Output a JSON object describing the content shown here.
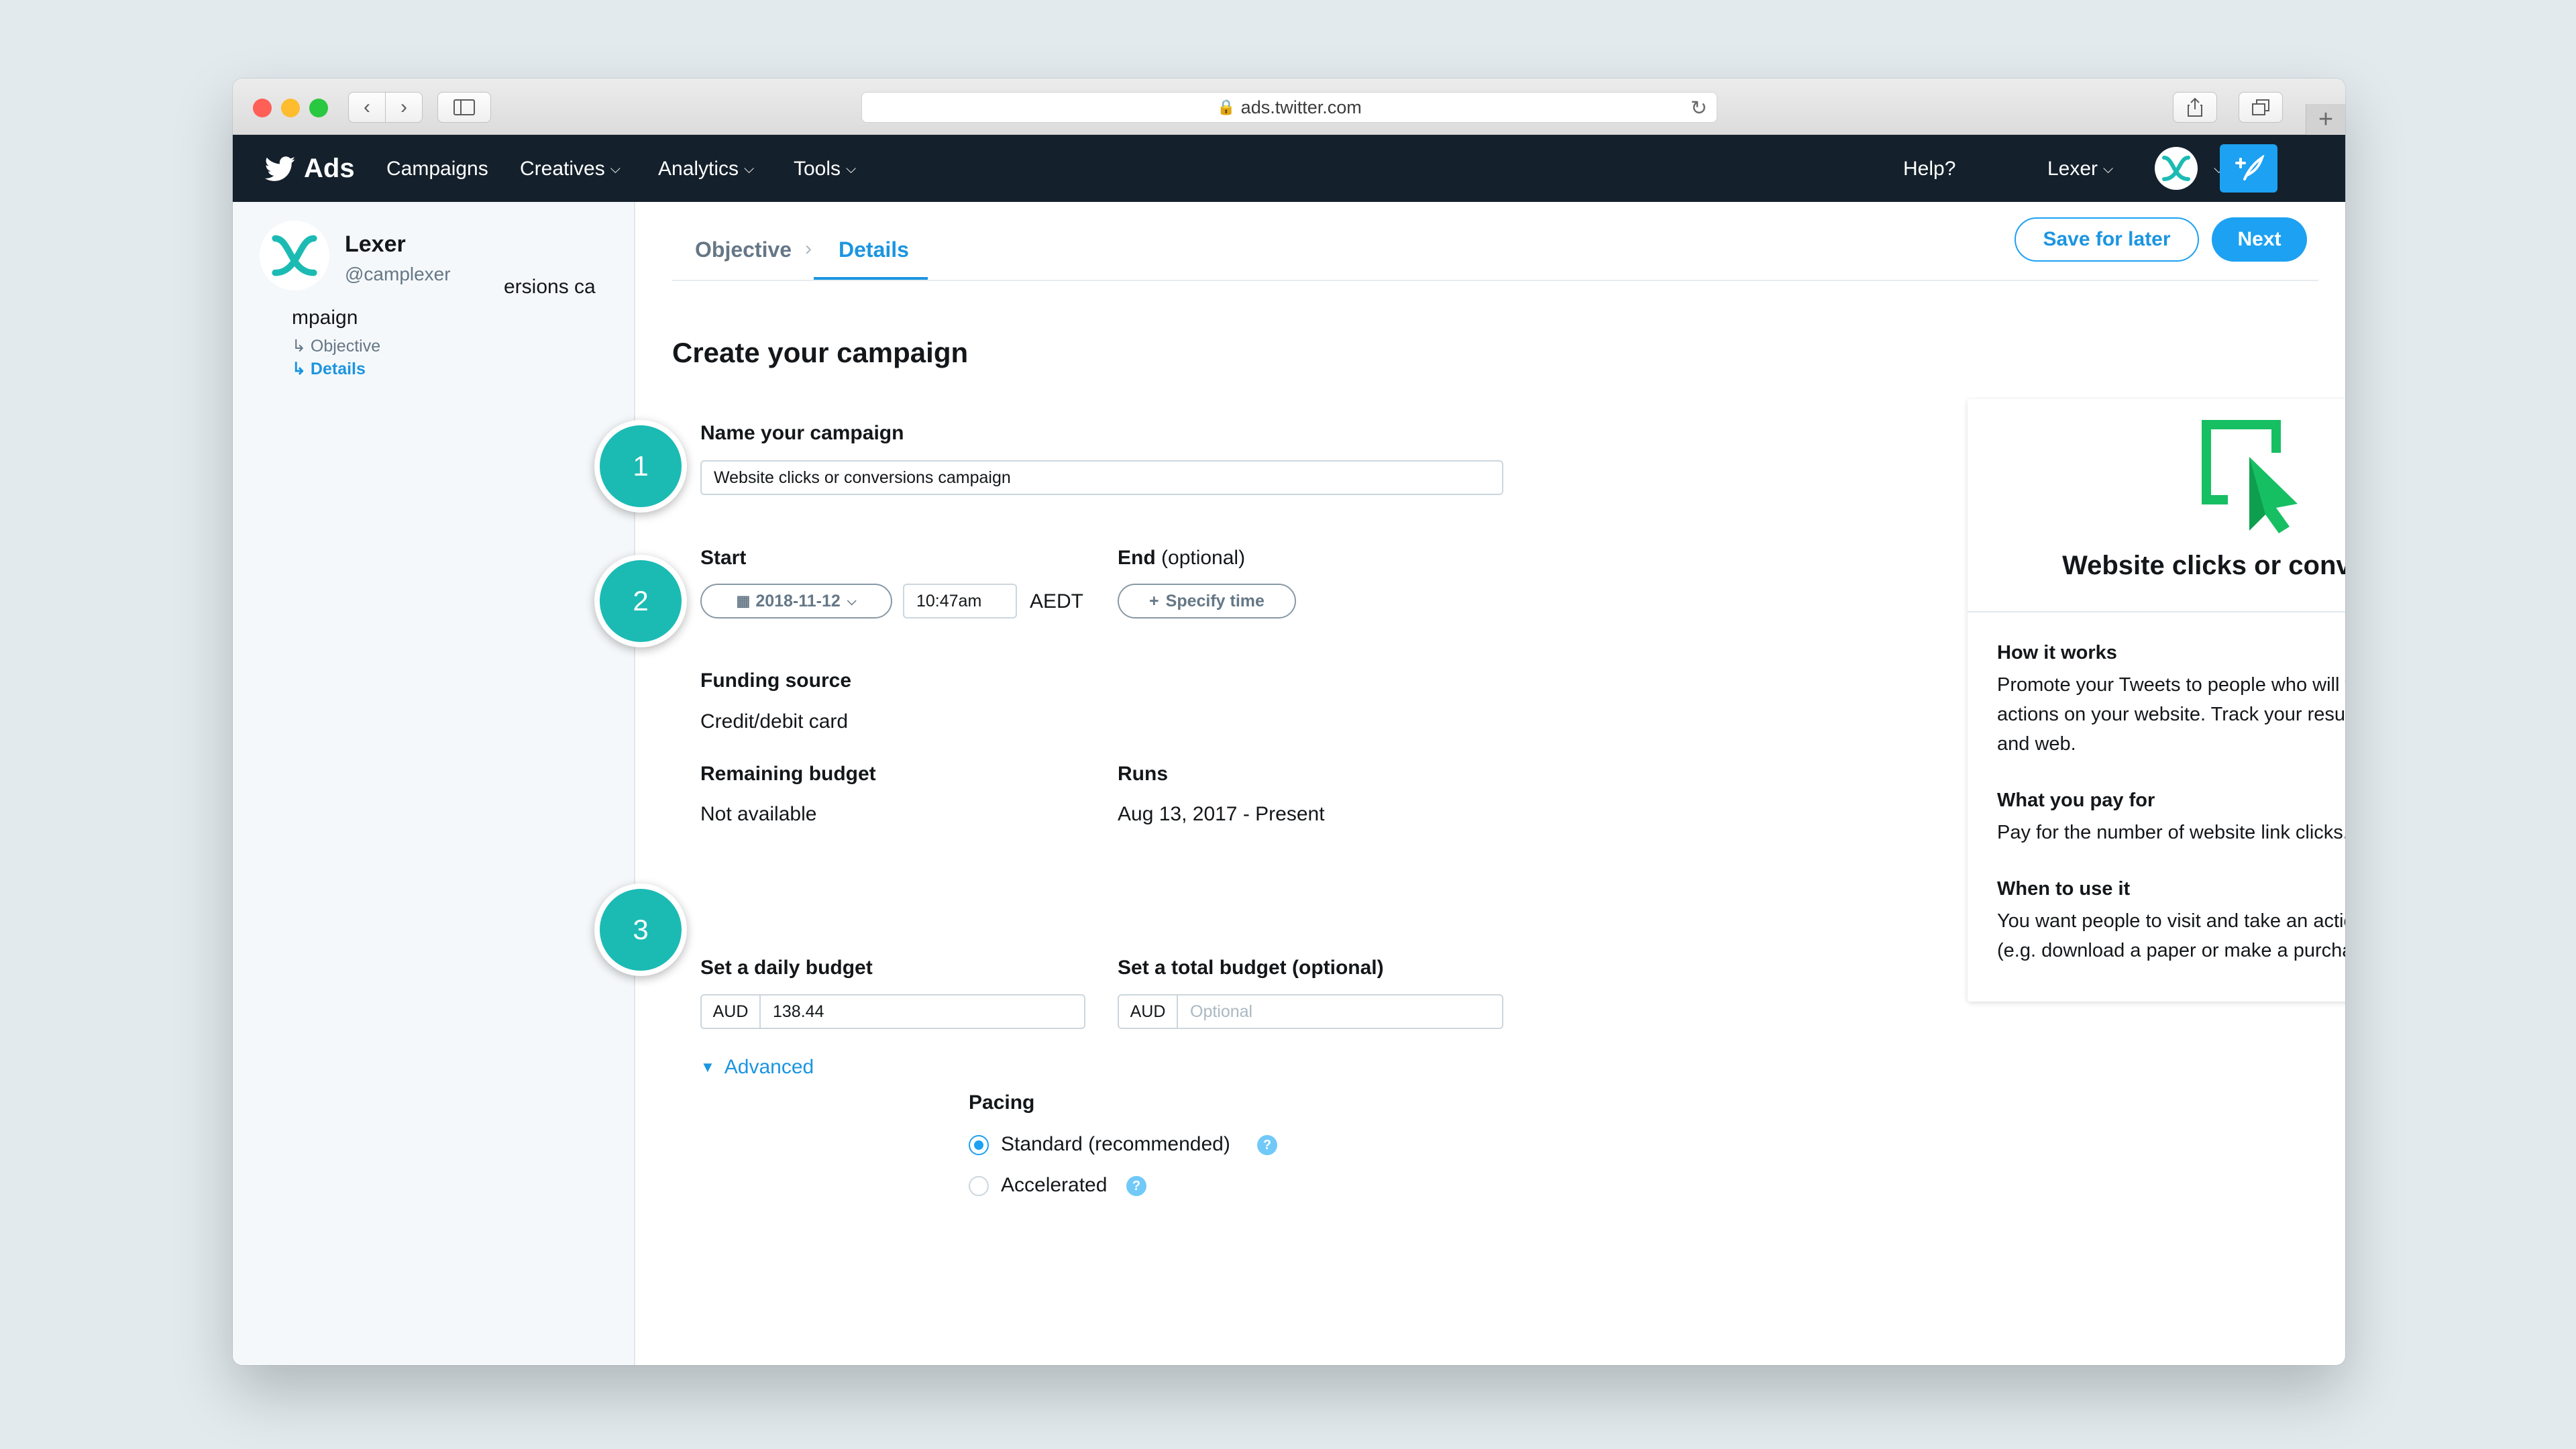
{
  "browser": {
    "url": "ads.twitter.com"
  },
  "topnav": {
    "brand": "Ads",
    "items": [
      "Campaigns",
      "Creatives",
      "Analytics",
      "Tools"
    ],
    "help": "Help?",
    "account": "Lexer"
  },
  "sidebar": {
    "account_name": "Lexer",
    "account_handle": "@camplexer",
    "overflow_text": "ersions ca",
    "campaign_text": "mpaign",
    "nav": [
      "Objective",
      "Details"
    ]
  },
  "tabs": {
    "objective": "Objective",
    "details": "Details"
  },
  "actions": {
    "save_for_later": "Save for later",
    "next": "Next"
  },
  "form": {
    "title": "Create your campaign",
    "steps": [
      "1",
      "2",
      "3"
    ],
    "name_label": "Name your campaign",
    "name_value": "Website clicks or conversions campaign",
    "start_label": "Start",
    "start_date": "2018-11-12",
    "start_time": "10:47am",
    "timezone": "AEDT",
    "end_label": "End",
    "end_optional": "(optional)",
    "specify_time": "Specify time",
    "funding_label": "Funding source",
    "funding_value": "Credit/debit card",
    "remaining_label": "Remaining budget",
    "remaining_value": "Not available",
    "runs_label": "Runs",
    "runs_value": "Aug 13, 2017 - Present",
    "daily_label": "Set a daily budget",
    "daily_currency": "AUD",
    "daily_value": "138.44",
    "total_label": "Set a total budget (optional)",
    "total_currency": "AUD",
    "total_placeholder": "Optional",
    "advanced": "Advanced",
    "pacing_label": "Pacing",
    "pacing_options": [
      {
        "label": "Standard (recommended)",
        "selected": true
      },
      {
        "label": "Accelerated",
        "selected": false
      }
    ]
  },
  "info_card": {
    "title": "Website clicks or conversions",
    "sections": [
      {
        "heading": "How it works",
        "body": "Promote your Tweets to people who will visit and take actions on your website. Track your results across mobile and web."
      },
      {
        "heading": "What you pay for",
        "body": "Pay for the number of website link clicks."
      },
      {
        "heading": "When to use it",
        "body": "You want people to visit and take an action on your website (e.g. download a paper or make a purchase)."
      }
    ]
  },
  "colors": {
    "nav_bg": "#14202b",
    "accent": "#1da1f2",
    "step_teal": "#1bbbb4",
    "icon_green": "#17bf63"
  }
}
